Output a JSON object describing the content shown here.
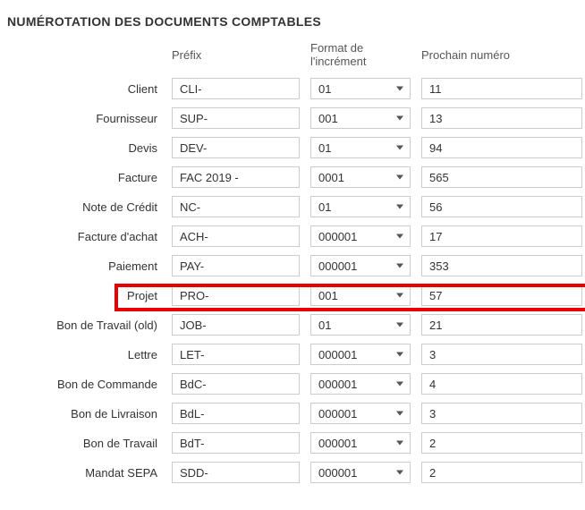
{
  "title": "NUMÉROTATION DES DOCUMENTS COMPTABLES",
  "headers": {
    "prefix": "Préfix",
    "format": "Format de l'incrément",
    "next": "Prochain numéro"
  },
  "rows": [
    {
      "label": "Client",
      "prefix": "CLI-",
      "format": "01",
      "next": "11"
    },
    {
      "label": "Fournisseur",
      "prefix": "SUP-",
      "format": "001",
      "next": "13"
    },
    {
      "label": "Devis",
      "prefix": "DEV-",
      "format": "01",
      "next": "94"
    },
    {
      "label": "Facture",
      "prefix": "FAC 2019 -",
      "format": "0001",
      "next": "565"
    },
    {
      "label": "Note de Crédit",
      "prefix": "NC-",
      "format": "01",
      "next": "56"
    },
    {
      "label": "Facture d'achat",
      "prefix": "ACH-",
      "format": "000001",
      "next": "17"
    },
    {
      "label": "Paiement",
      "prefix": "PAY-",
      "format": "000001",
      "next": "353"
    },
    {
      "label": "Projet",
      "prefix": "PRO-",
      "format": "001",
      "next": "57"
    },
    {
      "label": "Bon de Travail (old)",
      "prefix": "JOB-",
      "format": "01",
      "next": "21"
    },
    {
      "label": "Lettre",
      "prefix": "LET-",
      "format": "000001",
      "next": "3"
    },
    {
      "label": "Bon de Commande",
      "prefix": "BdC-",
      "format": "000001",
      "next": "4"
    },
    {
      "label": "Bon de Livraison",
      "prefix": "BdL-",
      "format": "000001",
      "next": "3"
    },
    {
      "label": "Bon de Travail",
      "prefix": "BdT-",
      "format": "000001",
      "next": "2"
    },
    {
      "label": "Mandat SEPA",
      "prefix": "SDD-",
      "format": "000001",
      "next": "2"
    }
  ],
  "highlight_row_index": 7
}
